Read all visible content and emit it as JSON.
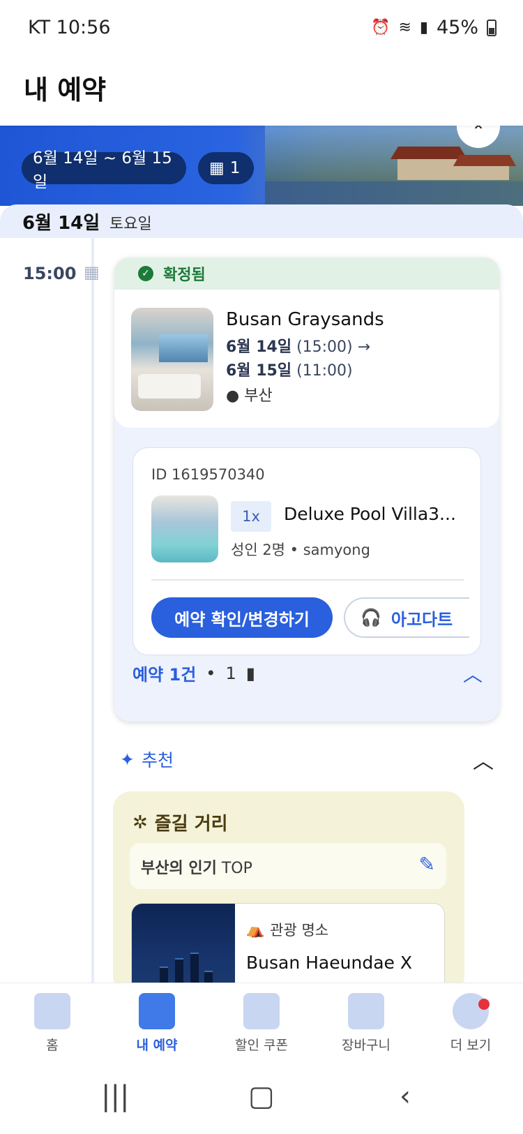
{
  "status_bar": {
    "carrier_time": "KT 10:56",
    "battery": "45%"
  },
  "header": {
    "title": "내 예약"
  },
  "banner": {
    "date_range": "6월 14일 ~ 6월 15일",
    "property_count": "1"
  },
  "day": {
    "date": "6월 14일",
    "weekday": "토요일"
  },
  "timeline": {
    "time": "15:00"
  },
  "reservation": {
    "status": "확정됨",
    "hotel_name": "Busan Graysands",
    "checkin_date": "6월 14일",
    "checkin_time": "(15:00)",
    "checkout_date": "6월 15일",
    "checkout_time": "(11:00)",
    "location": "부산",
    "booking": {
      "id_label": "ID 1619570340",
      "quantity": "1x",
      "room_name": "Deluxe Pool Villa3...",
      "guests": "성인 2명 • samyong",
      "primary_button": "예약 확인/변경하기",
      "support_button": "아고다트"
    },
    "summary": {
      "label": "예약 1건",
      "rooms": "1"
    }
  },
  "recommend": {
    "label": "추천",
    "fun_title": "즐길 거리",
    "top_label_bold": "부산의 인기",
    "top_label_rest": " TOP",
    "attraction": {
      "category": "관광 명소",
      "name": "Busan Haeundae X"
    }
  },
  "bottom_nav": {
    "items": [
      {
        "label": "홈",
        "icon": "home-icon"
      },
      {
        "label": "내 예약",
        "icon": "suitcase-icon"
      },
      {
        "label": "할인 쿠폰",
        "icon": "coupon-tag-icon"
      },
      {
        "label": "장바구니",
        "icon": "cart-icon"
      },
      {
        "label": "더 보기",
        "icon": "profile-icon"
      }
    ],
    "active_index": 1
  },
  "colors": {
    "primary": "#2a5fdd",
    "confirm_green": "#1c7a3a",
    "fun_bg": "#f4f2d8"
  }
}
